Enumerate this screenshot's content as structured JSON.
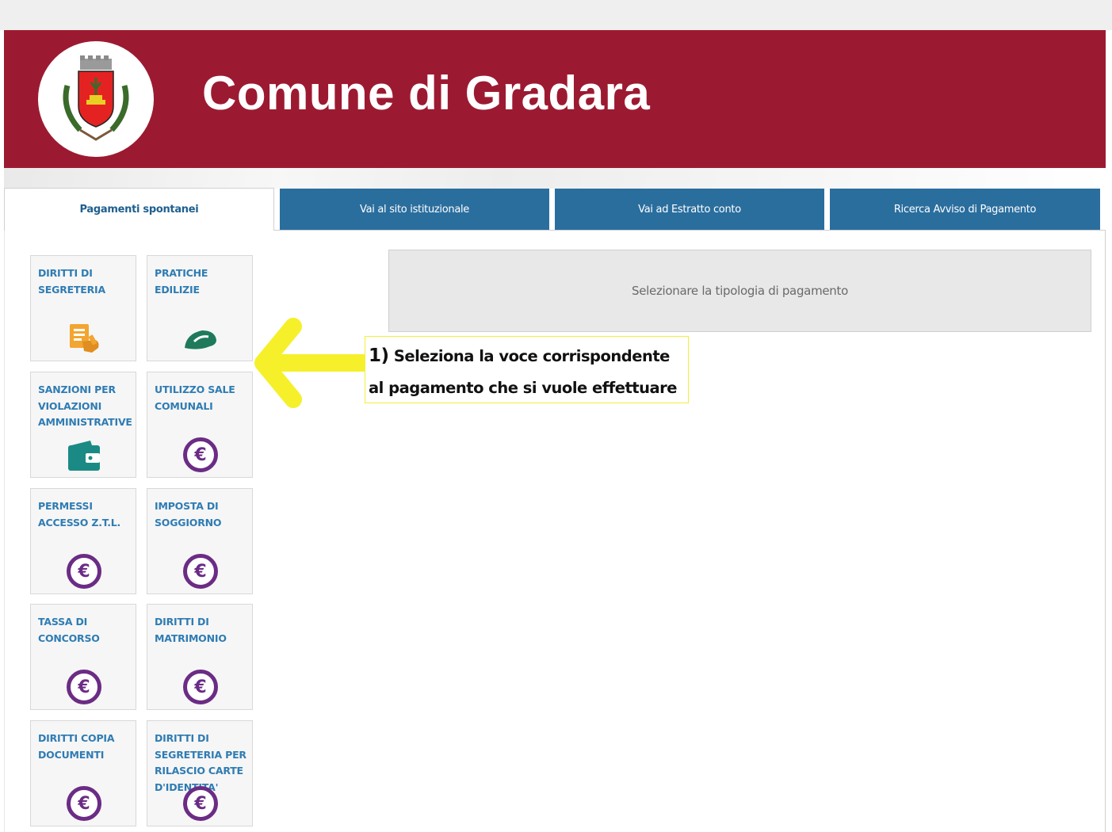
{
  "header": {
    "title": "Comune di Gradara",
    "brand_color": "#9c1a31"
  },
  "tabs": [
    {
      "label": "Pagamenti spontanei",
      "active": true
    },
    {
      "label": "Vai al sito istituzionale",
      "active": false
    },
    {
      "label": "Vai ad Estratto conto",
      "active": false
    },
    {
      "label": "Ricerca Avviso di Pagamento",
      "active": false
    }
  ],
  "tiles": [
    {
      "label": "DIRITTI DI SEGRETERIA",
      "icon": "document-hand-icon"
    },
    {
      "label": "PRATICHE EDILIZIE",
      "icon": "helmet-icon"
    },
    {
      "label": "SANZIONI PER VIOLAZIONI AMMINISTRATIVE",
      "icon": "wallet-icon"
    },
    {
      "label": "UTILIZZO SALE COMUNALI",
      "icon": "euro-icon"
    },
    {
      "label": "PERMESSI ACCESSO Z.T.L.",
      "icon": "euro-icon"
    },
    {
      "label": "IMPOSTA DI SOGGIORNO",
      "icon": "euro-icon"
    },
    {
      "label": "TASSA DI CONCORSO",
      "icon": "euro-icon"
    },
    {
      "label": "DIRITTI DI MATRIMONIO",
      "icon": "euro-icon"
    },
    {
      "label": "DIRITTI COPIA DOCUMENTI",
      "icon": "euro-icon"
    },
    {
      "label": "DIRITTI DI SEGRETERIA PER RILASCIO CARTE D'IDENTITA'",
      "icon": "euro-icon"
    }
  ],
  "euro_symbol": "€",
  "main": {
    "notice": "Selezionare la tipologia di pagamento"
  },
  "annotation": {
    "number": "1)",
    "text": "Seleziona la voce corrispondente al pagamento che si vuole effettuare",
    "arrow_color": "#f5f02a"
  }
}
